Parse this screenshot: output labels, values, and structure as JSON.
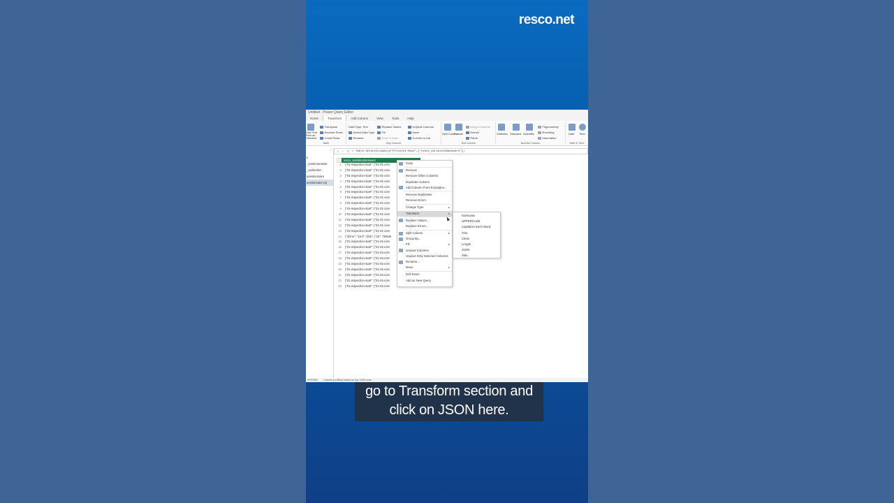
{
  "brand": "resco.net",
  "app": {
    "title": "Untitled - Power Query Editor",
    "menu": [
      "Home",
      "Transform",
      "Add Column",
      "View",
      "Tools",
      "Help"
    ],
    "active_menu": "Transform",
    "ribbon": {
      "table_group": {
        "label": "Table",
        "use_first_row": "Use First Row as Headers",
        "transpose": "Transpose",
        "reverse_rows": "Reverse Rows",
        "count_rows": "Count Rows"
      },
      "any_column_group": {
        "label": "Any Column",
        "data_type": "Data Type: Text",
        "detect_type": "Detect Data Type",
        "rename": "Rename",
        "replace_values": "Replace Values",
        "fill": "Fill",
        "pivot_column": "Pivot Column",
        "unpivot": "Unpivot Columns",
        "move": "Move",
        "convert_list": "Convert to List"
      },
      "text_column_group": {
        "label": "Text Column",
        "split": "Split Column",
        "format": "Format",
        "merge": "Merge Columns",
        "extract": "Extract",
        "parse": "Parse"
      },
      "number_column_group": {
        "label": "Number Column",
        "statistics": "Statistics",
        "standard": "Standard",
        "scientific": "Scientific",
        "trig": "Trigonometry",
        "rounding": "Rounding",
        "information": "Information"
      },
      "date_group": {
        "label": "Date & Time",
        "date": "Date",
        "time": "Time"
      }
    },
    "formula": "= Table.SelectColumns(#\"Filtered Rows\",{\"resco_serializedanswers\"})",
    "queries": [
      "s",
      "_customerasset",
      "_workorder",
      "questionnaire",
      "uestionnaire (2)"
    ],
    "column_name": "resco_serializedanswers",
    "rows": [
      {
        "n": "1",
        "v": "{\"01-inspection-start\": {\"01-01-com"
      },
      {
        "n": "2",
        "v": "{\"01-inspection-start\": {\"01-01-com"
      },
      {
        "n": "3",
        "v": "{\"01-inspection-start\": {\"01-01-com"
      },
      {
        "n": "4",
        "v": "{\"01-inspection-start\": {\"01-01-com"
      },
      {
        "n": "5",
        "v": "{\"01-inspection-start\": {\"01-01-com"
      },
      {
        "n": "6",
        "v": "{\"01-inspection-start\": {\"01-01-com"
      },
      {
        "n": "7",
        "v": "{\"01-inspection-start\": {\"01-01-com"
      },
      {
        "n": "8",
        "v": "{\"01-inspection-start\": {\"01-01-com"
      },
      {
        "n": "9",
        "v": "{\"01-inspection-start\": {\"01-01-com"
      },
      {
        "n": "10",
        "v": "{\"01-inspection-start\": {\"01-01-com"
      },
      {
        "n": "11",
        "v": "{\"01-inspection-start\": {\"01-01-com"
      },
      {
        "n": "12",
        "v": "{\"01-inspection-start\": {\"01-01-com"
      },
      {
        "n": "13",
        "v": "{\"01-inspection-start\": {\"01-01-com"
      },
      {
        "n": "14",
        "v": "{\"@me\": \"15.0\",\"@is\": {\"10\": \"00606"
      },
      {
        "n": "15",
        "v": "{\"01-inspection-start\": {\"01-01-com"
      },
      {
        "n": "16",
        "v": "{\"01-inspection-start\": {\"01-01-com"
      },
      {
        "n": "17",
        "v": "{\"01-inspection-start\": {\"01-01-com"
      },
      {
        "n": "18",
        "v": "{\"01-inspection-start\": {\"01-01-com"
      },
      {
        "n": "19",
        "v": "{\"01-inspection-start\": {\"01-01-com"
      },
      {
        "n": "20",
        "v": "{\"01-inspection-start\": {\"01-01-com"
      },
      {
        "n": "21",
        "v": "{\"01-inspection-start\": {\"01-01-com"
      },
      {
        "n": "22",
        "v": "{\"01-inspection-start\": {\"01-01-com"
      },
      {
        "n": "23",
        "v": "{\"01-inspection-start\": {\"01-01-com"
      }
    ],
    "context_menu": [
      {
        "label": "Copy",
        "icon": "copy-icon"
      },
      {
        "sep": true
      },
      {
        "label": "Remove",
        "icon": "remove-icon"
      },
      {
        "label": "Remove Other Columns",
        "icon": ""
      },
      {
        "label": "Duplicate Column",
        "icon": ""
      },
      {
        "label": "Add Column From Examples...",
        "icon": "add-column-icon"
      },
      {
        "sep": true
      },
      {
        "label": "Remove Duplicates",
        "icon": ""
      },
      {
        "label": "Remove Errors",
        "icon": ""
      },
      {
        "sep": true
      },
      {
        "label": "Change Type",
        "icon": "",
        "sub": true
      },
      {
        "label": "Transform",
        "icon": "",
        "sub": true,
        "highlight": true
      },
      {
        "sep": true
      },
      {
        "label": "Replace Values...",
        "icon": "replace-icon"
      },
      {
        "label": "Replace Errors...",
        "icon": ""
      },
      {
        "sep": true
      },
      {
        "label": "Split Column",
        "icon": "split-icon",
        "sub": true
      },
      {
        "label": "Group By...",
        "icon": "group-icon"
      },
      {
        "label": "Fill",
        "icon": "",
        "sub": true
      },
      {
        "label": "Unpivot Columns",
        "icon": "unpivot-icon"
      },
      {
        "label": "Unpivot Only Selected Columns",
        "icon": ""
      },
      {
        "label": "Rename...",
        "icon": "rename-icon"
      },
      {
        "label": "Move",
        "icon": "",
        "sub": true
      },
      {
        "sep": true
      },
      {
        "label": "Drill Down",
        "icon": ""
      },
      {
        "label": "Add as New Query",
        "icon": ""
      }
    ],
    "transform_submenu": [
      "lowercase",
      "UPPERCASE",
      "Capitalize Each Word",
      "Trim",
      "Clean",
      "Length",
      "JSON",
      "XML"
    ],
    "status": {
      "rows": "5 ROWS",
      "profiling": "Column profiling based on top 1000 rows"
    }
  },
  "caption": {
    "line1": "go to Transform section and",
    "line2": "click on JSON here."
  }
}
